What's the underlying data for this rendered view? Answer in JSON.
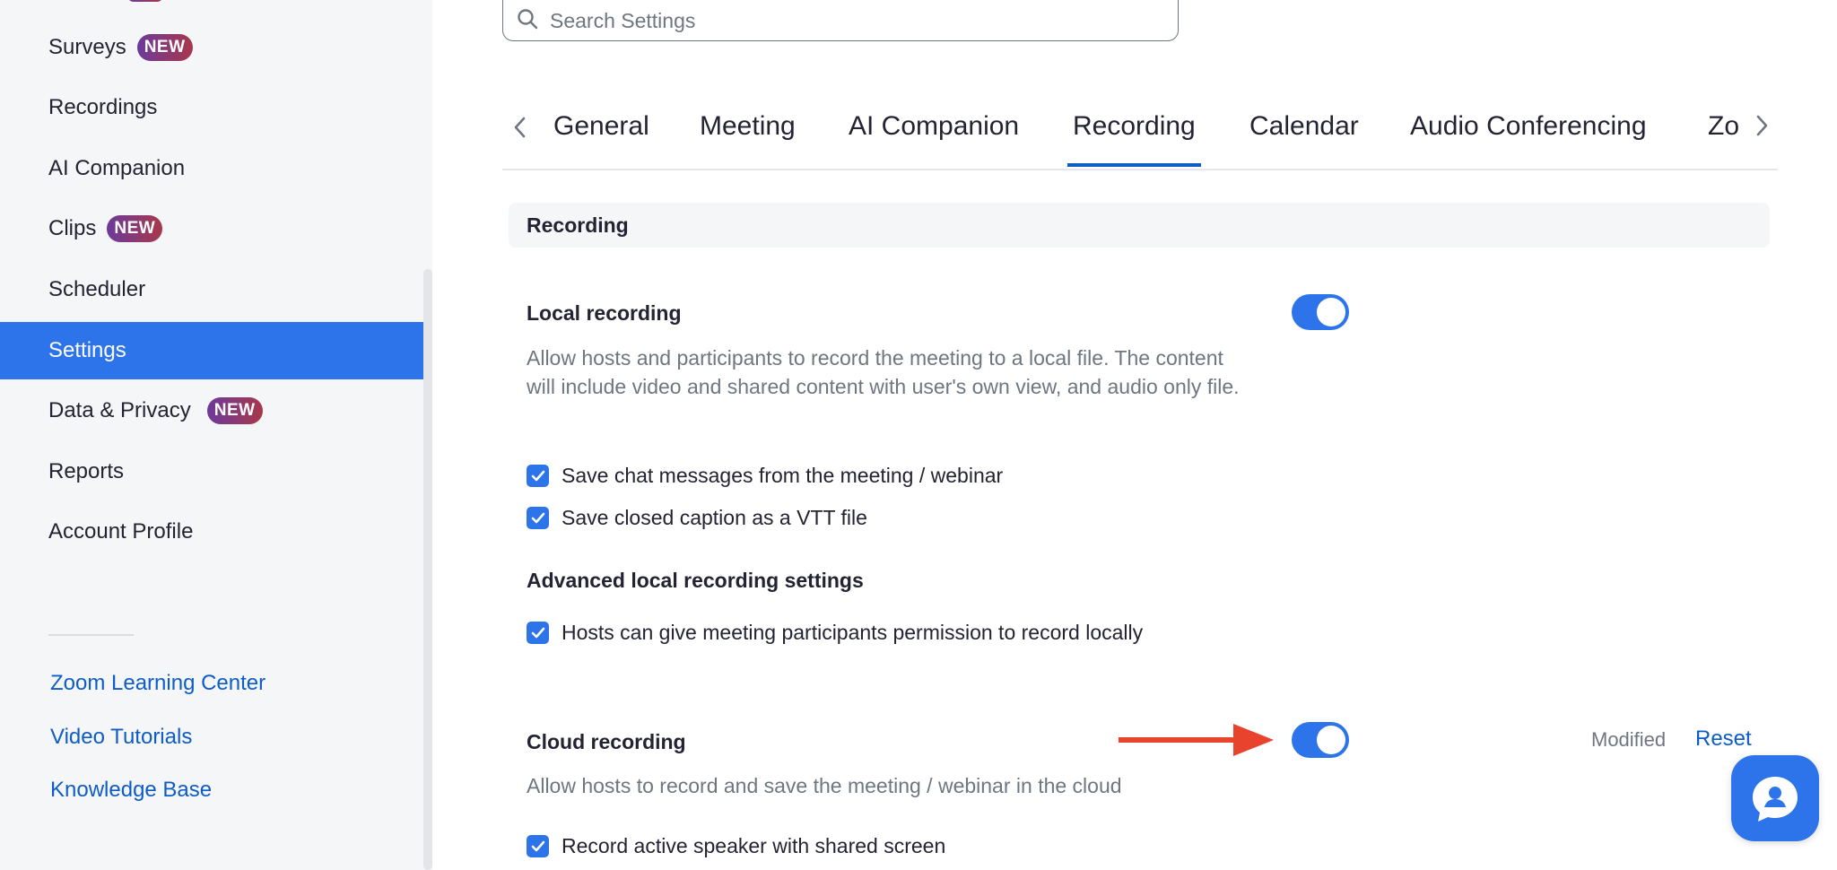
{
  "sidebar": {
    "items": [
      {
        "label": "Surveys",
        "badge": "NEW"
      },
      {
        "label": "Recordings"
      },
      {
        "label": "AI Companion"
      },
      {
        "label": "Clips",
        "badge": "NEW"
      },
      {
        "label": "Scheduler"
      },
      {
        "label": "Settings",
        "active": true
      },
      {
        "label": "Data & Privacy",
        "badge": "NEW"
      },
      {
        "label": "Reports"
      },
      {
        "label": "Account Profile"
      }
    ],
    "links": [
      {
        "label": "Zoom Learning Center"
      },
      {
        "label": "Video Tutorials"
      },
      {
        "label": "Knowledge Base"
      }
    ]
  },
  "search": {
    "placeholder": "Search Settings",
    "value": ""
  },
  "tabs": [
    {
      "label": "General"
    },
    {
      "label": "Meeting"
    },
    {
      "label": "AI Companion"
    },
    {
      "label": "Recording",
      "active": true
    },
    {
      "label": "Calendar"
    },
    {
      "label": "Audio Conferencing"
    },
    {
      "label": "Zo"
    }
  ],
  "section": {
    "title": "Recording"
  },
  "local_recording": {
    "title": "Local recording",
    "enabled": true,
    "description": "Allow hosts and participants to record the meeting to a local file. The content will include video and shared content with user's own view, and audio only file.",
    "options": [
      {
        "label": "Save chat messages from the meeting / webinar",
        "checked": true
      },
      {
        "label": "Save closed caption as a VTT file",
        "checked": true
      }
    ],
    "advanced_title": "Advanced local recording settings",
    "advanced_options": [
      {
        "label": "Hosts can give meeting participants permission to record locally",
        "checked": true
      }
    ]
  },
  "cloud_recording": {
    "title": "Cloud recording",
    "enabled": true,
    "modified_label": "Modified",
    "reset_label": "Reset",
    "description": "Allow hosts to record and save the meeting / webinar in the cloud",
    "options": [
      {
        "label": "Record active speaker with shared screen",
        "checked": true
      }
    ]
  },
  "colors": {
    "accent": "#2d74ea",
    "link": "#0e5cc8",
    "arrow": "#e8432d",
    "badge_start": "#6c3a9c",
    "badge_end": "#a8384b"
  },
  "icons": {
    "search": "search-icon",
    "tab_prev": "chevron-left-icon",
    "tab_next": "chevron-right-icon",
    "check": "checkmark-icon",
    "chat": "chat-support-icon",
    "annotation": "red-arrow-icon"
  }
}
